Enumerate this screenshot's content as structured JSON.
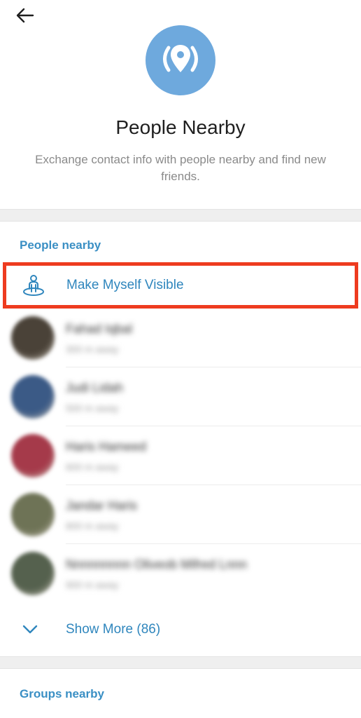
{
  "header": {
    "title": "People Nearby",
    "subtitle": "Exchange contact info with people nearby and find new friends.",
    "hero_color": "#6ea9dd"
  },
  "people_section": {
    "header": "People nearby",
    "make_visible_label": "Make Myself Visible",
    "highlight_color": "#ee3b1f",
    "people": [
      {
        "name": "Fahad Iqbal",
        "distance": "300 m away",
        "avatar_color": "#4a4238"
      },
      {
        "name": "Judi Lidah",
        "distance": "500 m away",
        "avatar_color": "#3b5a86"
      },
      {
        "name": "Haris Hameed",
        "distance": "600 m away",
        "avatar_color": "#a53a4a"
      },
      {
        "name": "Jandar Haris",
        "distance": "800 m away",
        "avatar_color": "#6e7356"
      },
      {
        "name": "Nnnnnnnnn Oliveob Mifred Lnnn",
        "distance": "900 m away",
        "avatar_color": "#55614e"
      }
    ],
    "show_more_label": "Show More (86)"
  },
  "groups_section": {
    "header": "Groups nearby"
  },
  "accent_color": "#2f86bd"
}
